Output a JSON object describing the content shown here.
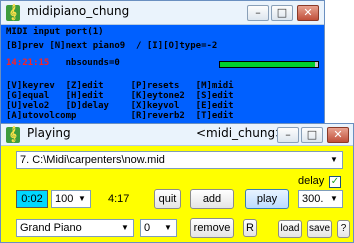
{
  "window_main": {
    "title": "midipiano_chung",
    "console": {
      "line1": "MIDI input port(1)",
      "line2": "[B]prev [N]next piano9  / [I][O]type=-2",
      "time": "14:21:15",
      "nbsounds": "nbsounds=0",
      "progress": 0.97,
      "menu": [
        "[V]keyrev  [Z]edit     [P]resets   [M]midi",
        "[G]equal   [H]edit     [K]eytone2  [S]edit",
        "[U]velo2   [D]delay    [X]keyvol   [E]edit",
        "[A]utovolcomp          [R]reverb2  [T]edit"
      ]
    }
  },
  "window_playing": {
    "title": "Playing",
    "subtitle": "<midi_chung>",
    "file": "7. C:\\Midi\\carpenters\\now.mid",
    "delay_label": "delay",
    "delay_checked": true,
    "time_current": "0:02",
    "volume": "100",
    "duration": "4:17",
    "quit_label": "quit",
    "add_label": "add",
    "play_label": "play",
    "tempo": "300.",
    "instrument": "Grand Piano",
    "program": "0",
    "remove_label": "remove",
    "r_label": "R",
    "load_label": "load",
    "save_label": "save",
    "help_label": "?"
  },
  "colors": {
    "console_bg": "#0060ff",
    "time_color": "#ff2020",
    "progress_fill": "#00d030",
    "playing_bg": "#ffff00"
  }
}
